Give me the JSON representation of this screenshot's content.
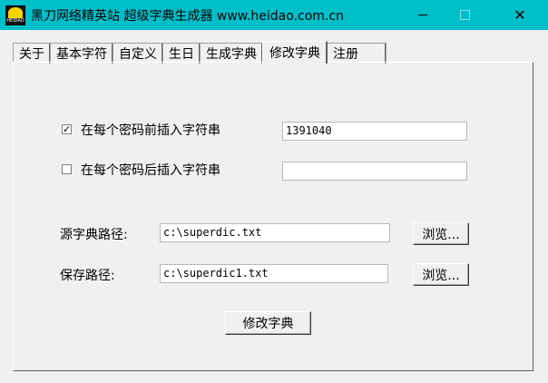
{
  "window": {
    "title": "黑刀网络精英站 超级字典生成器 www.heidao.com.cn",
    "icon_text": "HEIDAO"
  },
  "tabs": [
    {
      "label": "关于"
    },
    {
      "label": "基本字符"
    },
    {
      "label": "自定义"
    },
    {
      "label": "生日"
    },
    {
      "label": "生成字典"
    },
    {
      "label": "修改字典",
      "active": true
    },
    {
      "label": "注册"
    }
  ],
  "form": {
    "prefix_check_label": "在每个密码前插入字符串",
    "prefix_checked": "✓",
    "prefix_value": "1391040",
    "suffix_check_label": "在每个密码后插入字符串",
    "suffix_value": "",
    "source_label": "源字典路径:",
    "source_value": "c:\\superdic.txt",
    "source_browse": "浏览...",
    "save_label": "保存路径:",
    "save_value": "c:\\superdic1.txt",
    "save_browse": "浏览...",
    "modify_button": "修改字典"
  },
  "icons": {
    "minimize": "minimize-icon",
    "maximize": "maximize-icon",
    "close": "close-icon"
  },
  "colors": {
    "titlebar": "#00bfc9",
    "window_bg": "#f0f0f0"
  }
}
